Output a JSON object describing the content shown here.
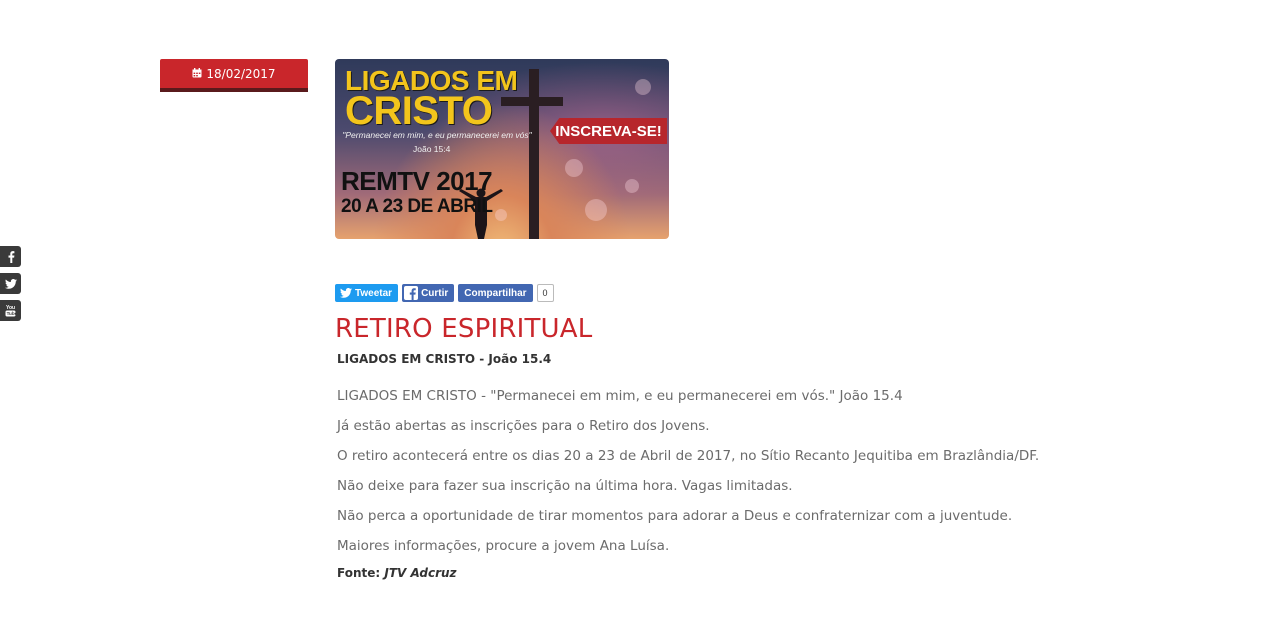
{
  "social": {
    "items": [
      {
        "icon": "facebook-icon"
      },
      {
        "icon": "twitter-icon"
      },
      {
        "icon": "youtube-icon"
      }
    ]
  },
  "post": {
    "date": "18/02/2017",
    "date_icon": "calendar-icon"
  },
  "banner": {
    "title_line1": "LIGADOS EM",
    "title_line2": "CRISTO",
    "quote": "\"Permanecei em mim, e eu permanecerei em vós\"",
    "reference": "João 15:4",
    "cta": "INSCREVA-SE!",
    "event_line1": "REMTV 2017",
    "event_line2": "20 A 23 DE ABRIL"
  },
  "share": {
    "tweet_label": "Tweetar",
    "like_label": "Curtir",
    "share_label": "Compartilhar",
    "share_count": "0"
  },
  "article": {
    "title": "RETIRO ESPIRITUAL",
    "subtitle": "LIGADOS EM CRISTO - João 15.4",
    "paragraphs": [
      "LIGADOS EM CRISTO - \"Permanecei em mim, e eu permanecerei em vós.\" João 15.4",
      "Já estão abertas as inscrições para o Retiro dos Jovens.",
      "O retiro acontecerá entre os dias 20 a 23 de Abril de 2017, no Sítio Recanto Jequitiba em Brazlândia/DF.",
      "Não deixe para fazer sua inscrição na última hora. Vagas limitadas.",
      "Não perca a oportunidade de tirar momentos para adorar a Deus e confraternizar com a juventude.",
      "Maiores informações, procure a jovem Ana Luísa."
    ],
    "source_label": "Fonte:",
    "source_value": "JTV Adcruz"
  },
  "colors": {
    "accent_red": "#c9262b",
    "twitter_blue": "#1d9bf0",
    "facebook_blue": "#4267b2",
    "banner_yellow": "#f3c51c"
  }
}
